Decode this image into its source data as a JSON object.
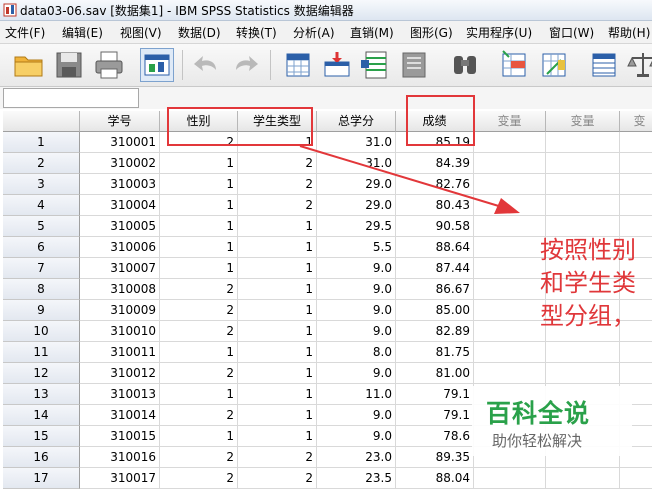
{
  "window": {
    "title": "data03-06.sav [数据集1] - IBM SPSS Statistics 数据编辑器"
  },
  "menu": [
    {
      "label": "文件(F)"
    },
    {
      "label": "编辑(E)"
    },
    {
      "label": "视图(V)"
    },
    {
      "label": "数据(D)"
    },
    {
      "label": "转换(T)"
    },
    {
      "label": "分析(A)"
    },
    {
      "label": "直销(M)"
    },
    {
      "label": "图形(G)"
    },
    {
      "label": "实用程序(U)"
    },
    {
      "label": "窗口(W)"
    },
    {
      "label": "帮助(H)"
    }
  ],
  "toolbar": {
    "icons": [
      "open-folder-icon",
      "save-icon",
      "print-icon",
      "dialog-recall-icon",
      "undo-icon",
      "redo-icon",
      "goto-case-icon",
      "goto-variable-icon",
      "variables-icon",
      "run-descriptives-icon",
      "find-icon",
      "insert-cases-icon",
      "insert-variable-icon",
      "split-file-icon",
      "weight-cases-icon"
    ]
  },
  "grid": {
    "columns": [
      "学号",
      "性别",
      "学生类型",
      "总学分",
      "成绩",
      "变量",
      "变量",
      "变"
    ],
    "rows": [
      {
        "n": "1",
        "id": "310001",
        "gender": "2",
        "type": "1",
        "credits": "31.0",
        "score": "85.19"
      },
      {
        "n": "2",
        "id": "310002",
        "gender": "1",
        "type": "2",
        "credits": "31.0",
        "score": "84.39"
      },
      {
        "n": "3",
        "id": "310003",
        "gender": "1",
        "type": "2",
        "credits": "29.0",
        "score": "82.76"
      },
      {
        "n": "4",
        "id": "310004",
        "gender": "1",
        "type": "2",
        "credits": "29.0",
        "score": "80.43"
      },
      {
        "n": "5",
        "id": "310005",
        "gender": "1",
        "type": "1",
        "credits": "29.5",
        "score": "90.58"
      },
      {
        "n": "6",
        "id": "310006",
        "gender": "1",
        "type": "1",
        "credits": "5.5",
        "score": "88.64"
      },
      {
        "n": "7",
        "id": "310007",
        "gender": "1",
        "type": "1",
        "credits": "9.0",
        "score": "87.44"
      },
      {
        "n": "8",
        "id": "310008",
        "gender": "2",
        "type": "1",
        "credits": "9.0",
        "score": "86.67"
      },
      {
        "n": "9",
        "id": "310009",
        "gender": "2",
        "type": "1",
        "credits": "9.0",
        "score": "85.00"
      },
      {
        "n": "10",
        "id": "310010",
        "gender": "2",
        "type": "1",
        "credits": "9.0",
        "score": "82.89"
      },
      {
        "n": "11",
        "id": "310011",
        "gender": "1",
        "type": "1",
        "credits": "8.0",
        "score": "81.75"
      },
      {
        "n": "12",
        "id": "310012",
        "gender": "2",
        "type": "1",
        "credits": "9.0",
        "score": "81.00"
      },
      {
        "n": "13",
        "id": "310013",
        "gender": "1",
        "type": "1",
        "credits": "11.0",
        "score": "79.1"
      },
      {
        "n": "14",
        "id": "310014",
        "gender": "2",
        "type": "1",
        "credits": "9.0",
        "score": "79.1"
      },
      {
        "n": "15",
        "id": "310015",
        "gender": "1",
        "type": "1",
        "credits": "9.0",
        "score": "78.6"
      },
      {
        "n": "16",
        "id": "310016",
        "gender": "2",
        "type": "2",
        "credits": "23.0",
        "score": "89.35"
      },
      {
        "n": "17",
        "id": "310017",
        "gender": "2",
        "type": "2",
        "credits": "23.5",
        "score": "88.04"
      }
    ]
  },
  "annotation": {
    "text": "按照性别和学生类型分组，",
    "color": "#e0373a"
  },
  "watermark": {
    "title": "百科全说",
    "subtitle": "助你轻松解决",
    "color": "#2aa14a"
  }
}
